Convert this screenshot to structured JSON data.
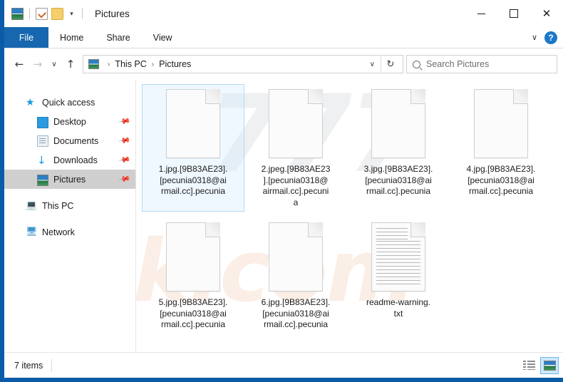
{
  "window": {
    "title": "Pictures",
    "quick_access_icons": [
      "pictures-folder-icon",
      "properties-icon",
      "new-folder-icon",
      "customize-caret-icon"
    ],
    "controls": {
      "minimize": "–",
      "maximize": "□",
      "close": "✕"
    }
  },
  "ribbon": {
    "tabs": [
      {
        "label": "File",
        "active": true
      },
      {
        "label": "Home",
        "active": false
      },
      {
        "label": "Share",
        "active": false
      },
      {
        "label": "View",
        "active": false
      }
    ],
    "expand_caret": "∨",
    "help_label": "?"
  },
  "address_bar": {
    "back": "←",
    "forward": "→",
    "recent": "∨",
    "up": "↑",
    "crumbs": [
      "This PC",
      "Pictures"
    ],
    "crumb_separator": "›",
    "crumb_caret": "∨",
    "refresh": "↻"
  },
  "search": {
    "placeholder": "Search Pictures",
    "value": ""
  },
  "sidebar": {
    "items": [
      {
        "label": "Quick access",
        "icon": "star-icon",
        "level": 0,
        "selected": false,
        "pinned": false
      },
      {
        "label": "Desktop",
        "icon": "desktop-icon",
        "level": 1,
        "selected": false,
        "pinned": true
      },
      {
        "label": "Documents",
        "icon": "documents-icon",
        "level": 1,
        "selected": false,
        "pinned": true
      },
      {
        "label": "Downloads",
        "icon": "downloads-icon",
        "level": 1,
        "selected": false,
        "pinned": true
      },
      {
        "label": "Pictures",
        "icon": "pictures-icon",
        "level": 1,
        "selected": true,
        "pinned": true
      },
      {
        "label": "This PC",
        "icon": "this-pc-icon",
        "level": 0,
        "selected": false,
        "pinned": false
      },
      {
        "label": "Network",
        "icon": "network-icon",
        "level": 0,
        "selected": false,
        "pinned": false
      }
    ],
    "pin_glyph": "📌"
  },
  "files": [
    {
      "name": "1.jpg.[9B83AE23].[pecunia0318@airmail.cc].pecunia",
      "display": "1.jpg.[9B83AE23].\n[pecunia0318@ai\nrmail.cc].pecunia",
      "icon": "blank-file-icon",
      "selected": true
    },
    {
      "name": "2.jpeg.[9B83AE23].[pecunia0318@airmail.cc].pecunia",
      "display": "2.jpeg.[9B83AE23\n].[pecunia0318@\nairmail.cc].pecuni\na",
      "icon": "blank-file-icon",
      "selected": false
    },
    {
      "name": "3.jpg.[9B83AE23].[pecunia0318@airmail.cc].pecunia",
      "display": "3.jpg.[9B83AE23].\n[pecunia0318@ai\nrmail.cc].pecunia",
      "icon": "blank-file-icon",
      "selected": false
    },
    {
      "name": "4.jpg.[9B83AE23].[pecunia0318@airmail.cc].pecunia",
      "display": "4.jpg.[9B83AE23].\n[pecunia0318@ai\nrmail.cc].pecunia",
      "icon": "blank-file-icon",
      "selected": false
    },
    {
      "name": "5.jpg.[9B83AE23].[pecunia0318@airmail.cc].pecunia",
      "display": "5.jpg.[9B83AE23].\n[pecunia0318@ai\nrmail.cc].pecunia",
      "icon": "blank-file-icon",
      "selected": false
    },
    {
      "name": "6.jpg.[9B83AE23].[pecunia0318@airmail.cc].pecunia",
      "display": "6.jpg.[9B83AE23].\n[pecunia0318@ai\nrmail.cc].pecunia",
      "icon": "blank-file-icon",
      "selected": false
    },
    {
      "name": "readme-warning.txt",
      "display": "readme-warning.\ntxt",
      "icon": "text-file-icon",
      "selected": false
    }
  ],
  "status": {
    "item_count": "7 items",
    "views": [
      {
        "name": "details-view",
        "active": false
      },
      {
        "name": "large-icons-view",
        "active": true
      }
    ]
  },
  "watermark": {
    "top": "777",
    "bottom": "risk.com"
  },
  "colors": {
    "frame_blue": "#0b5ca8",
    "file_tab_blue": "#1767b0",
    "selection_blue": "#cde8ff",
    "nav_selected_gray": "#cfcfcf"
  }
}
